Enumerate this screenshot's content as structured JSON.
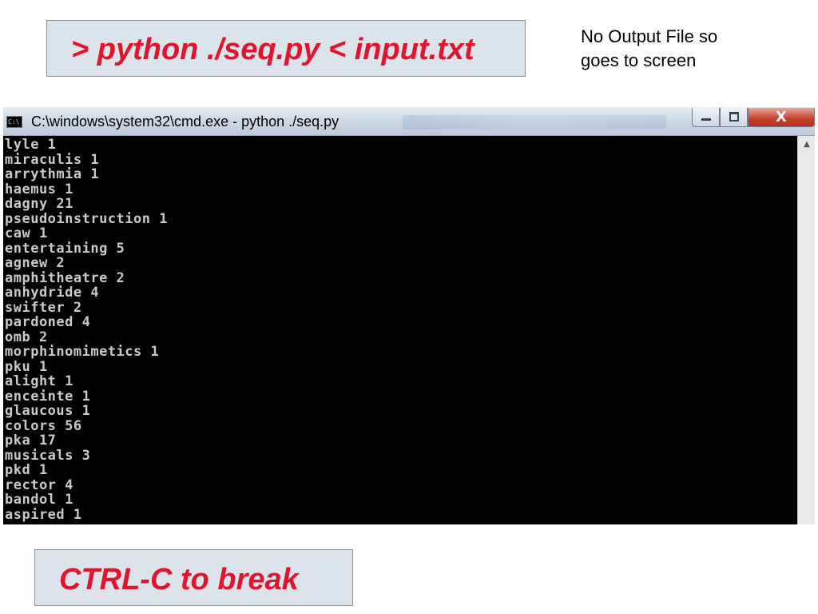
{
  "slide": {
    "command_text": "> python ./seq.py < input.txt",
    "note_line1": "No Output File so",
    "note_line2": "goes to screen",
    "break_text": "CTRL-C to break",
    "accent_color": "#e3132b",
    "box_color": "#dde3ea"
  },
  "window": {
    "title": "C:\\windows\\system32\\cmd.exe - python  ./seq.py",
    "icon": "cmd-icon",
    "icon_text": "C:\\",
    "minimize_icon": "minimize-icon",
    "maximize_icon": "maximize-icon",
    "close_icon": "close-icon",
    "close_label": "X",
    "scroll_up_glyph": "▲"
  },
  "console": {
    "lines": [
      "lyle 1",
      "miraculis 1",
      "arrythmia 1",
      "haemus 1",
      "dagny 21",
      "pseudoinstruction 1",
      "caw 1",
      "entertaining 5",
      "agnew 2",
      "amphitheatre 2",
      "anhydride 4",
      "swifter 2",
      "pardoned 4",
      "omb 2",
      "morphinomimetics 1",
      "pku 1",
      "alight 1",
      "enceinte 1",
      "glaucous 1",
      "colors 56",
      "pka 17",
      "musicals 3",
      "pkd 1",
      "rector 4",
      "bandol 1",
      "aspired 1"
    ]
  }
}
